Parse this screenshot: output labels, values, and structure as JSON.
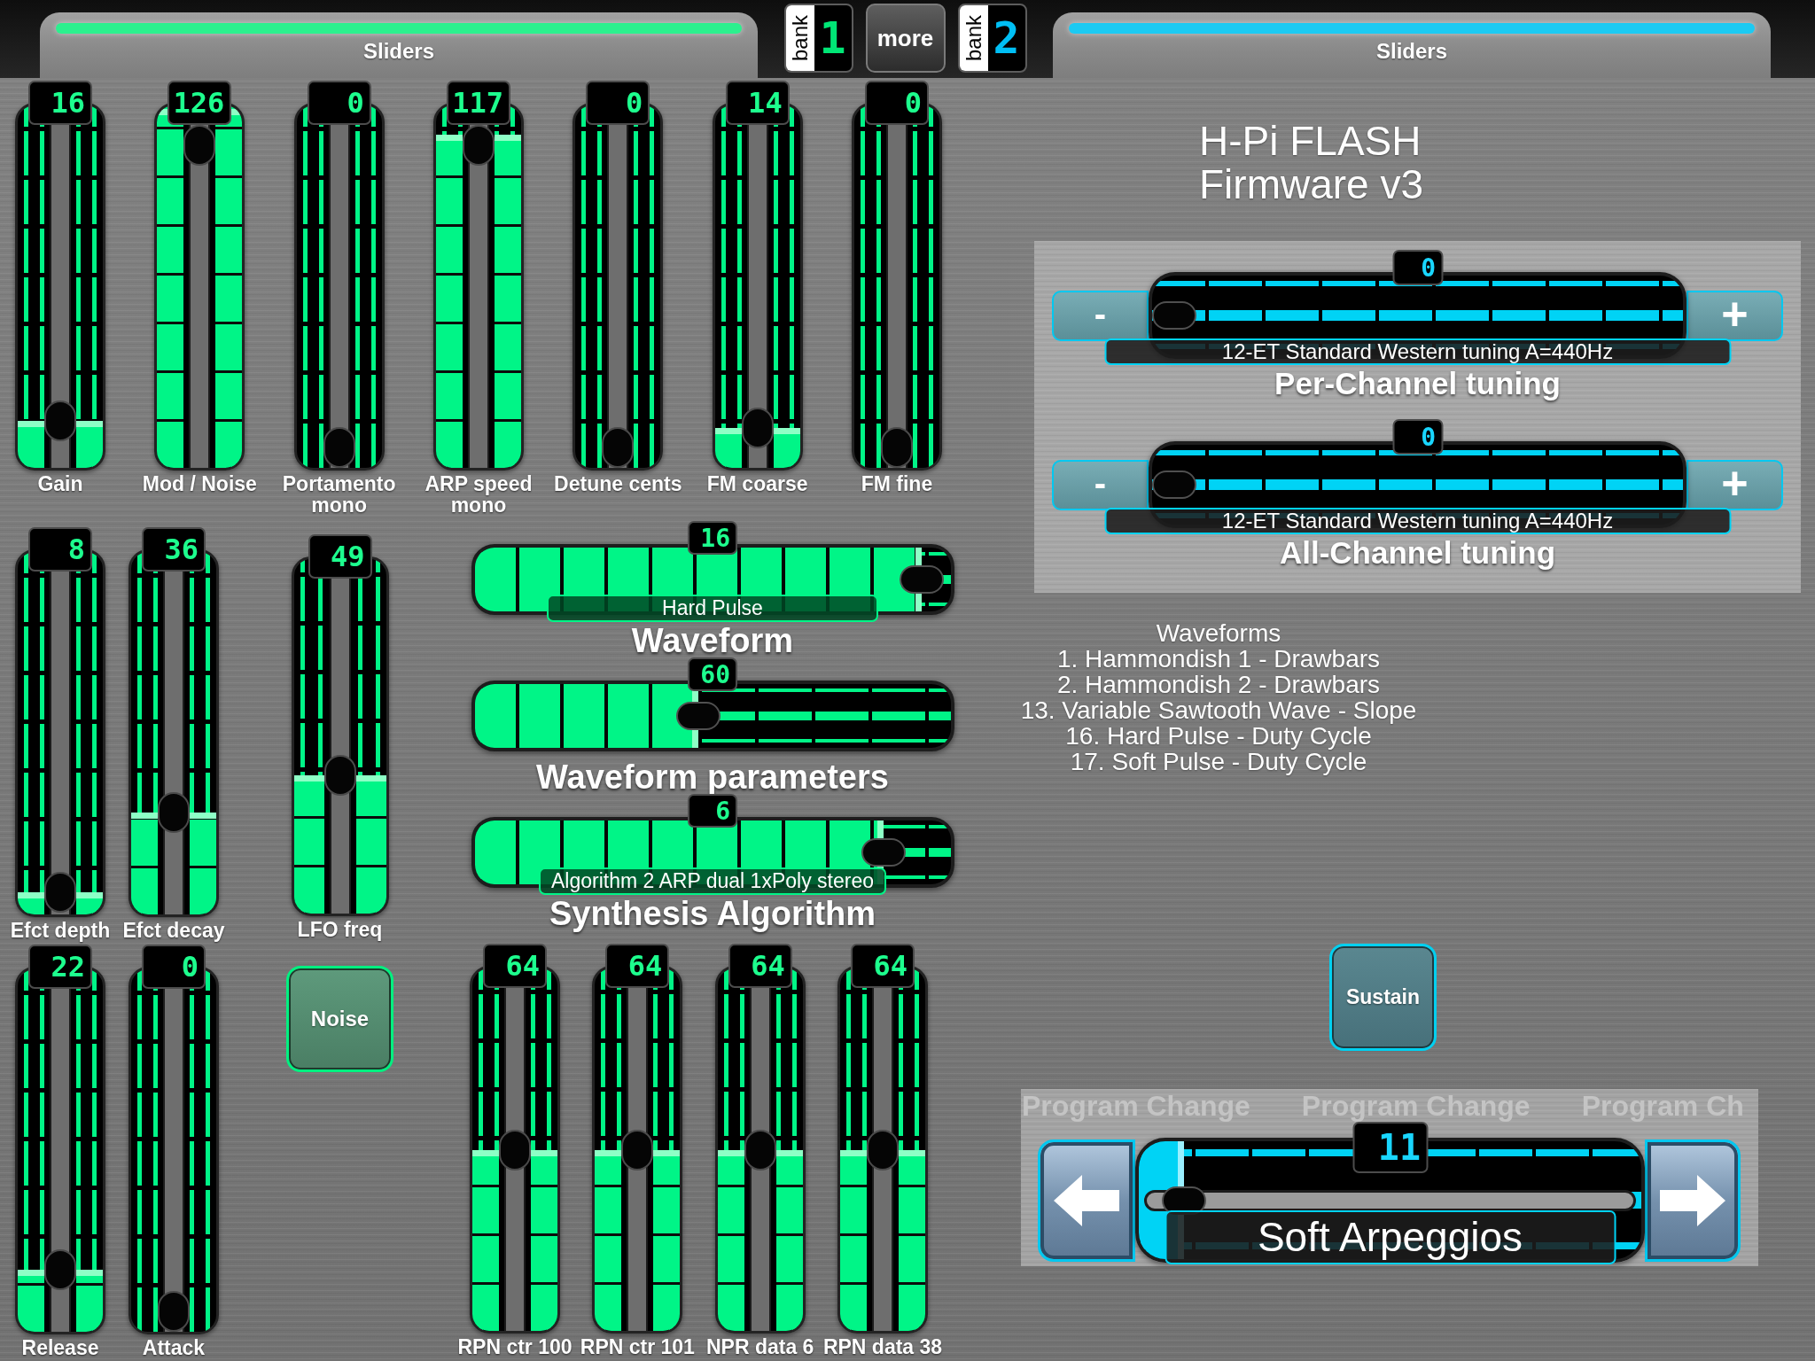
{
  "top_bar": {
    "panels": [
      {
        "label": "Sliders",
        "color": "#2cf08e"
      },
      {
        "label": "Sliders",
        "color": "#1ccaf2"
      }
    ],
    "buttons": [
      {
        "kind": "bank",
        "caption": "bank",
        "number": "1",
        "color": "#00e676"
      },
      {
        "kind": "plain",
        "label": "more"
      },
      {
        "kind": "bank",
        "caption": "bank",
        "number": "2",
        "color": "#00bff5"
      }
    ]
  },
  "top_faders": [
    {
      "label": "Gain",
      "reading": "16",
      "level": 0.13
    },
    {
      "label": "Mod / Noise",
      "reading": "126",
      "level": 0.99
    },
    {
      "label": "Portamento mono",
      "reading": "0",
      "level": 0
    },
    {
      "label": "ARP speed mono",
      "reading": "117",
      "level": 0.92
    },
    {
      "label": "Detune cents",
      "reading": "0",
      "level": 0
    },
    {
      "label": "FM coarse",
      "reading": "14",
      "level": 0.11
    },
    {
      "label": "FM fine",
      "reading": "0",
      "level": 0
    }
  ],
  "effect_faders": [
    {
      "label": "Efct depth",
      "reading": "8",
      "level": 0.06
    },
    {
      "label": "Efct decay",
      "reading": "36",
      "level": 0.28
    }
  ],
  "lfo_fader": {
    "label": "LFO freq",
    "reading": "49",
    "level": 0.39
  },
  "envelope_faders": [
    {
      "label": "Release",
      "reading": "22",
      "level": 0.17
    },
    {
      "label": "Attack",
      "reading": "0",
      "level": 0
    }
  ],
  "noise_button": {
    "label": "Noise"
  },
  "selectors": [
    {
      "reading": "16",
      "level": 0.94,
      "value_label": "Hard Pulse",
      "title": "Waveform"
    },
    {
      "reading": "60",
      "level": 0.47,
      "title": "Waveform parameters"
    },
    {
      "reading": "6",
      "level": 0.86,
      "value_label": "Algorithm 2 ARP dual 1xPoly stereo",
      "title": "Synthesis Algorithm"
    }
  ],
  "rpn_faders": [
    {
      "label": "RPN ctr 100",
      "reading": "64",
      "level": 0.5
    },
    {
      "label": "RPN ctr 101",
      "reading": "64",
      "level": 0.5
    },
    {
      "label": "NPR data 6",
      "reading": "64",
      "level": 0.5
    },
    {
      "label": "RPN data 38",
      "reading": "64",
      "level": 0.5
    }
  ],
  "device_title": [
    "H-Pi FLASH",
    "Firmware v3"
  ],
  "tuning": [
    {
      "reading": "0",
      "level": 0,
      "minus_label": "-",
      "plus_label": "+",
      "value_label": "12-ET Standard Western tuning A=440Hz",
      "title": "Per-Channel tuning"
    },
    {
      "reading": "0",
      "level": 0,
      "minus_label": "-",
      "plus_label": "+",
      "value_label": "12-ET Standard Western tuning A=440Hz",
      "title": "All-Channel tuning"
    }
  ],
  "waveform_help": {
    "heading": "Waveforms",
    "lines": [
      "1. Hammondish 1 - Drawbars",
      "2. Hammondish 2 - Drawbars",
      "13. Variable Sawtooth Wave - Slope",
      "16. Hard Pulse - Duty Cycle",
      "17. Soft Pulse - Duty Cycle"
    ]
  },
  "sustain_button": {
    "label": "Sustain"
  },
  "program_change": {
    "background_labels": [
      "Program Change",
      "Program Change",
      "Program Ch"
    ],
    "reading": "11",
    "level": 0.09,
    "value_label": "Soft Arpeggios"
  }
}
